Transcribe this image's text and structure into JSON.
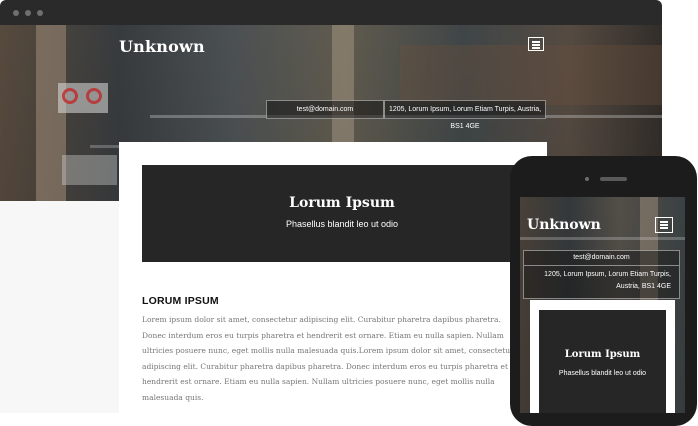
{
  "site": {
    "title": "Unknown"
  },
  "header": {
    "email": "test@domain.com",
    "address": "1205, Lorum Ipsum, Lorum Etiam Turpis, Austria, BS1 4GE"
  },
  "banner": {
    "title": "Lorum Ipsum",
    "subtitle": "Phasellus blandit leo ut odio"
  },
  "section": {
    "heading": "LORUM IPSUM",
    "body": "Lorem ipsum dolor sit amet, consectetur adipiscing elit. Curabitur pharetra dapibus pharetra. Donec interdum eros eu turpis pharetra et hendrerit est ornare. Etiam eu nulla sapien. Nullam ultricies posuere nunc, eget mollis nulla malesuada quis.Lorem ipsum dolor sit amet, consectetur adipiscing elit. Curabitur pharetra dapibus pharetra. Donec interdum eros eu turpis pharetra et hendrerit est ornare. Etiam eu nulla sapien. Nullam ultricies posuere nunc, eget mollis nulla malesuada quis."
  },
  "mobile": {
    "title": "Unknown",
    "email": "test@domain.com",
    "address": "1205, Lorum Ipsum, Lorum Etiam Turpis, Austria, BS1 4GE",
    "banner_title": "Lorum Ipsum",
    "banner_subtitle": "Phasellus blandit leo ut odio"
  },
  "icons": {
    "menu": "hamburger-menu-icon",
    "window_controls": [
      "window-dot-icon",
      "window-dot-icon",
      "window-dot-icon"
    ]
  },
  "colors": {
    "browser_chrome": "#2a2a2a",
    "banner_bg": "#262626",
    "heading_text": "#111111",
    "body_text": "#777777"
  }
}
